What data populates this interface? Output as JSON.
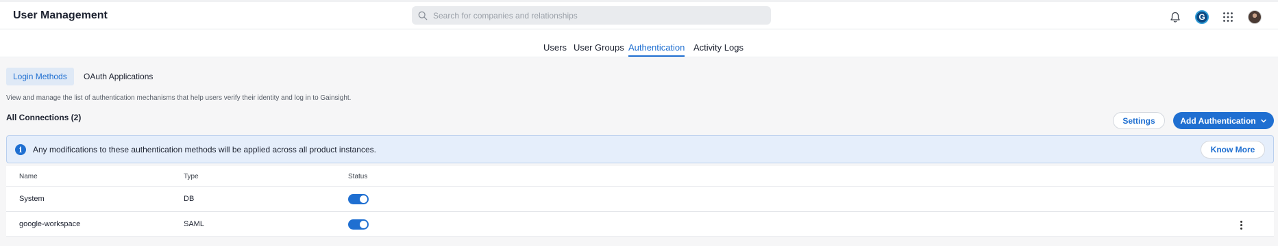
{
  "header": {
    "title": "User Management",
    "search_placeholder": "Search for companies and relationships",
    "icons": [
      "bell-icon",
      "gainsight-logo-icon",
      "apps-grid-icon",
      "user-avatar"
    ]
  },
  "main_tabs": [
    {
      "label": "Users",
      "active": false
    },
    {
      "label": "User Groups",
      "active": false
    },
    {
      "label": "Authentication",
      "active": true
    },
    {
      "label": "Activity Logs",
      "active": false
    }
  ],
  "sub_tabs": [
    {
      "label": "Login Methods",
      "active": true
    },
    {
      "label": "OAuth Applications",
      "active": false
    }
  ],
  "description": "View and manage the list of authentication mechanisms that help users verify their identity and log in to Gainsight.",
  "connections_title": "All Connections (2)",
  "buttons": {
    "settings": "Settings",
    "add_authentication": "Add Authentication"
  },
  "banner": {
    "message": "Any modifications to these authentication methods will be applied across all product instances.",
    "know_more": "Know More"
  },
  "table": {
    "columns": [
      "Name",
      "Type",
      "Status"
    ],
    "rows": [
      {
        "name": "System",
        "type": "DB",
        "status": true
      },
      {
        "name": "google-workspace",
        "type": "SAML",
        "status": true
      }
    ]
  },
  "colors": {
    "accent": "#1f6fd1",
    "banner_bg": "#e5eefb"
  }
}
